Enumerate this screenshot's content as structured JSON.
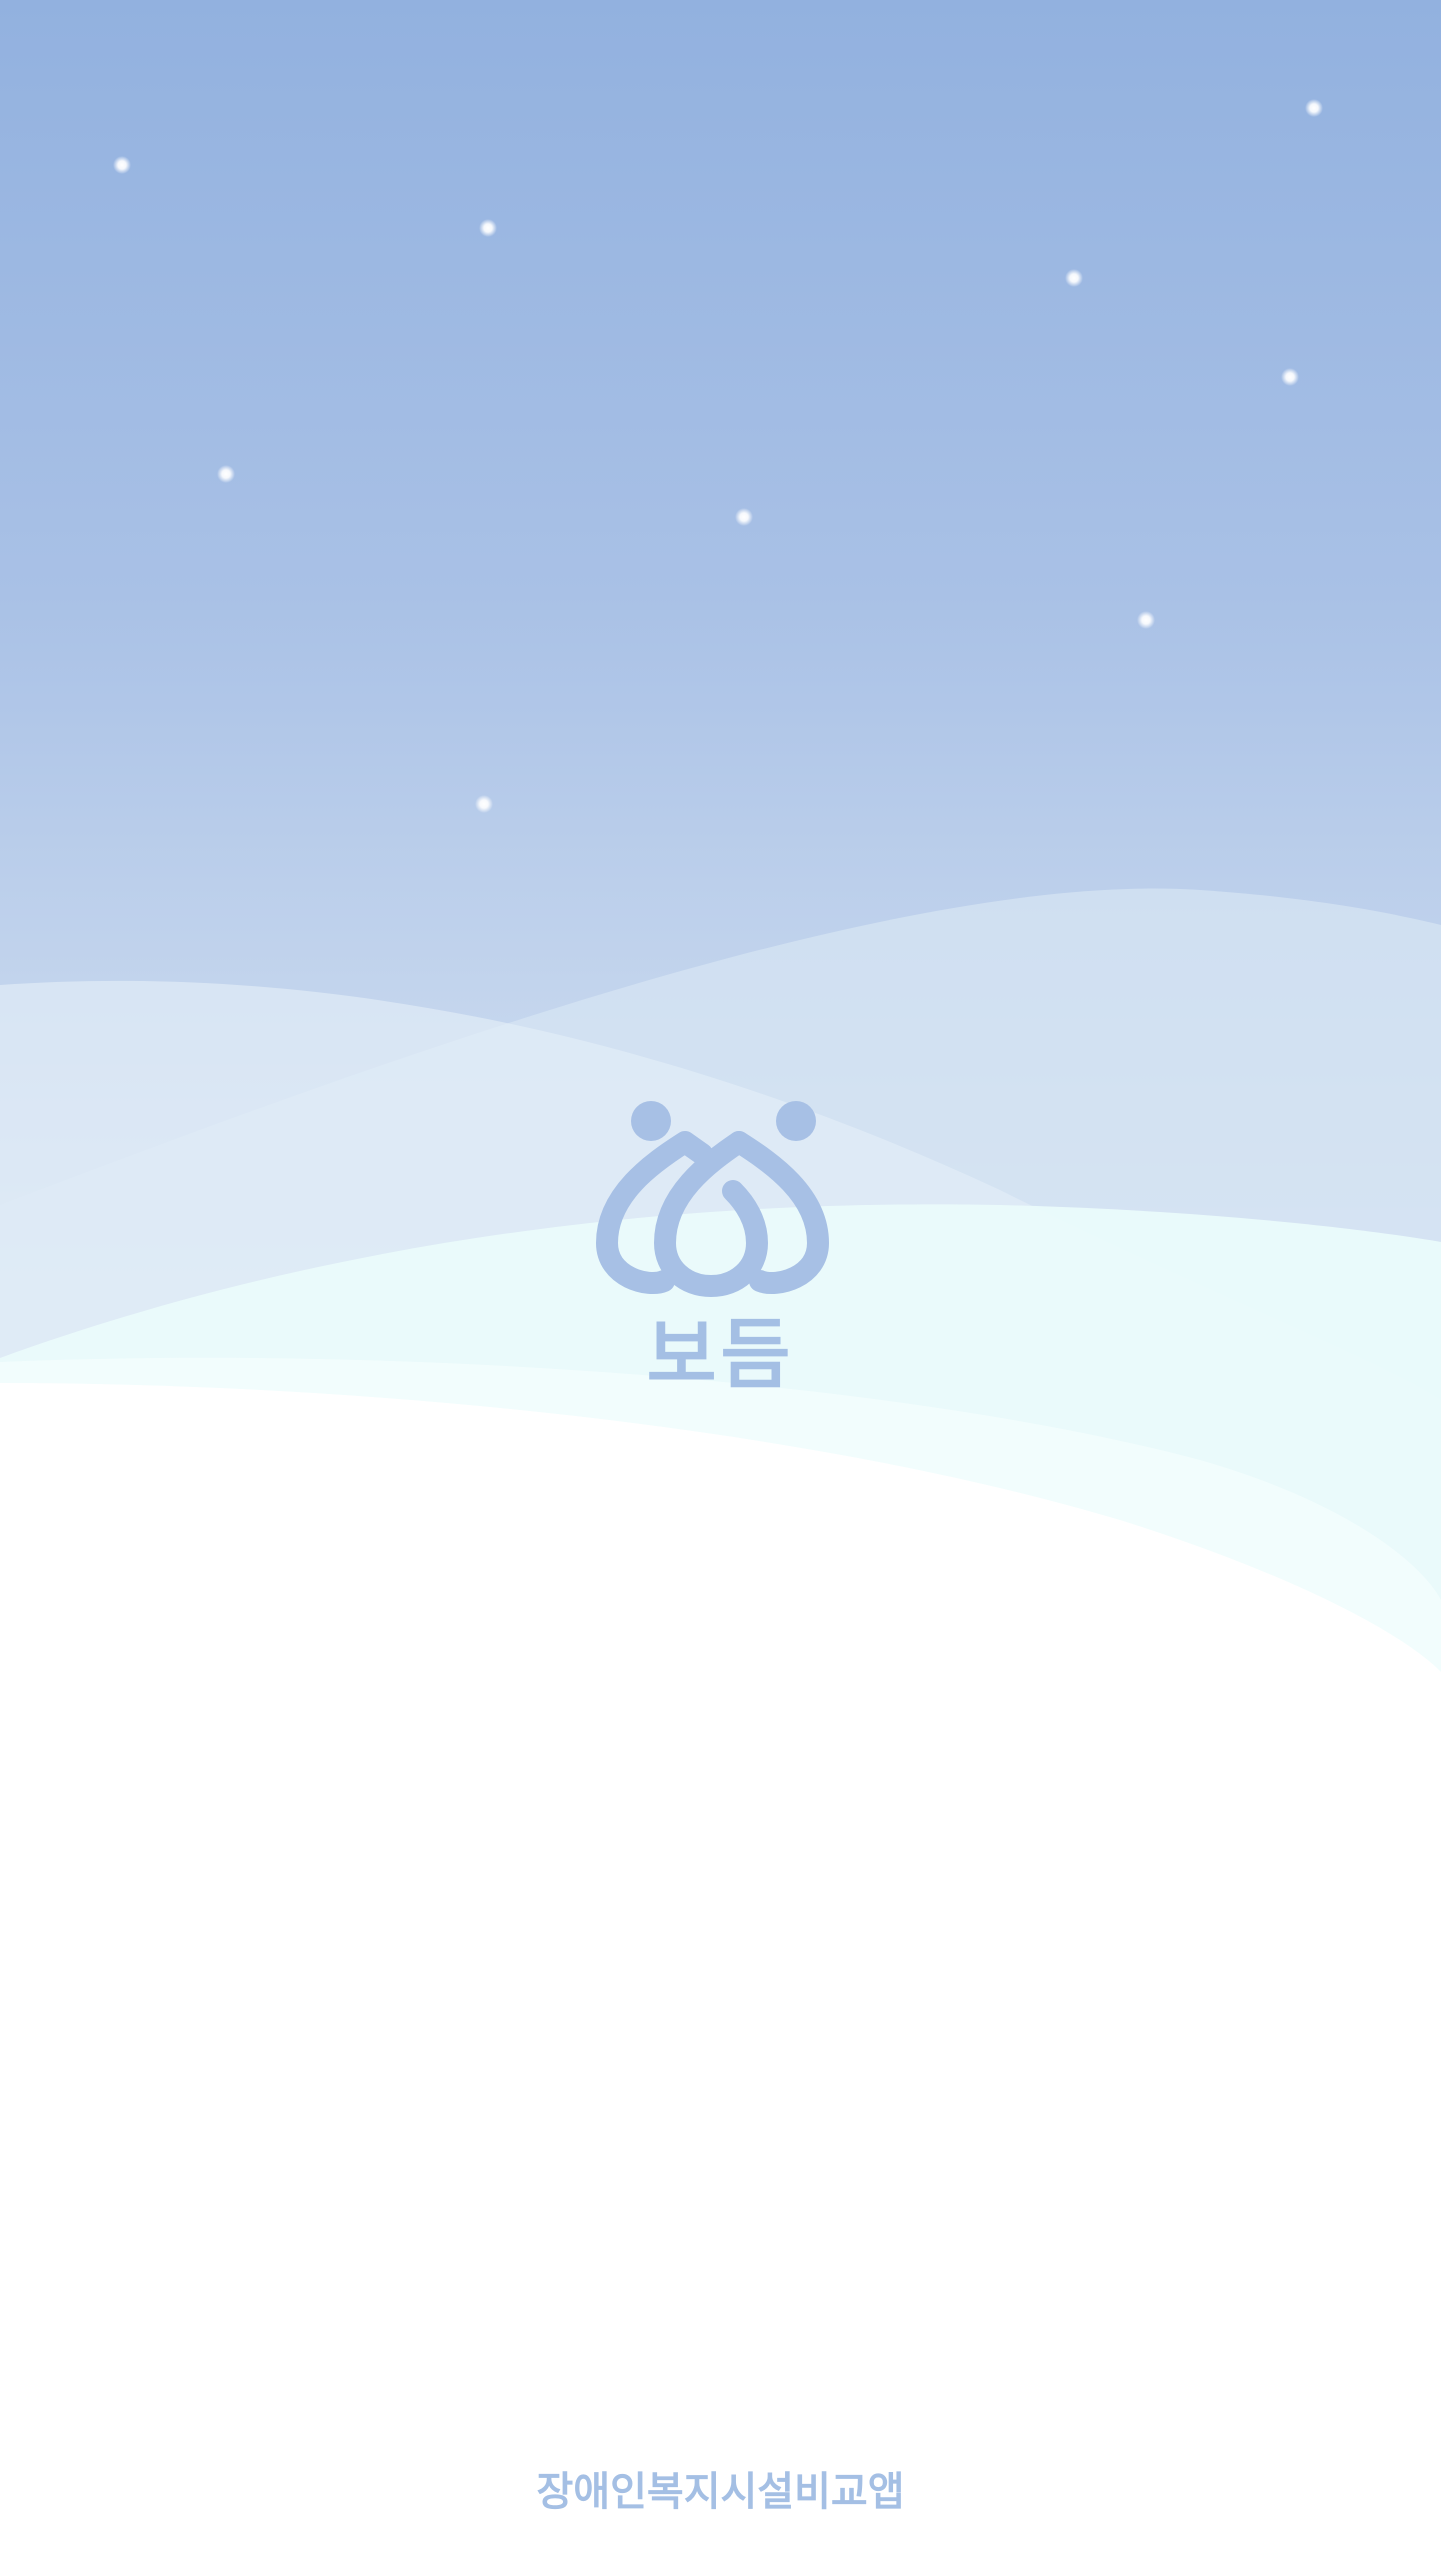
{
  "splash": {
    "app_name": "보듬",
    "tagline": "장애인복지시설비교앱"
  },
  "icons": {
    "logo": "two-people-heart-logo-icon",
    "background": "night-sky-with-stars-and-snow-waves"
  },
  "colors": {
    "sky_top": "#93b2df",
    "sky_bottom": "#dfe8f3",
    "snow": "#ffffff",
    "mint_wave": "#e9fbfb",
    "brand": "#a4bfe4",
    "star": "#ffffff"
  }
}
